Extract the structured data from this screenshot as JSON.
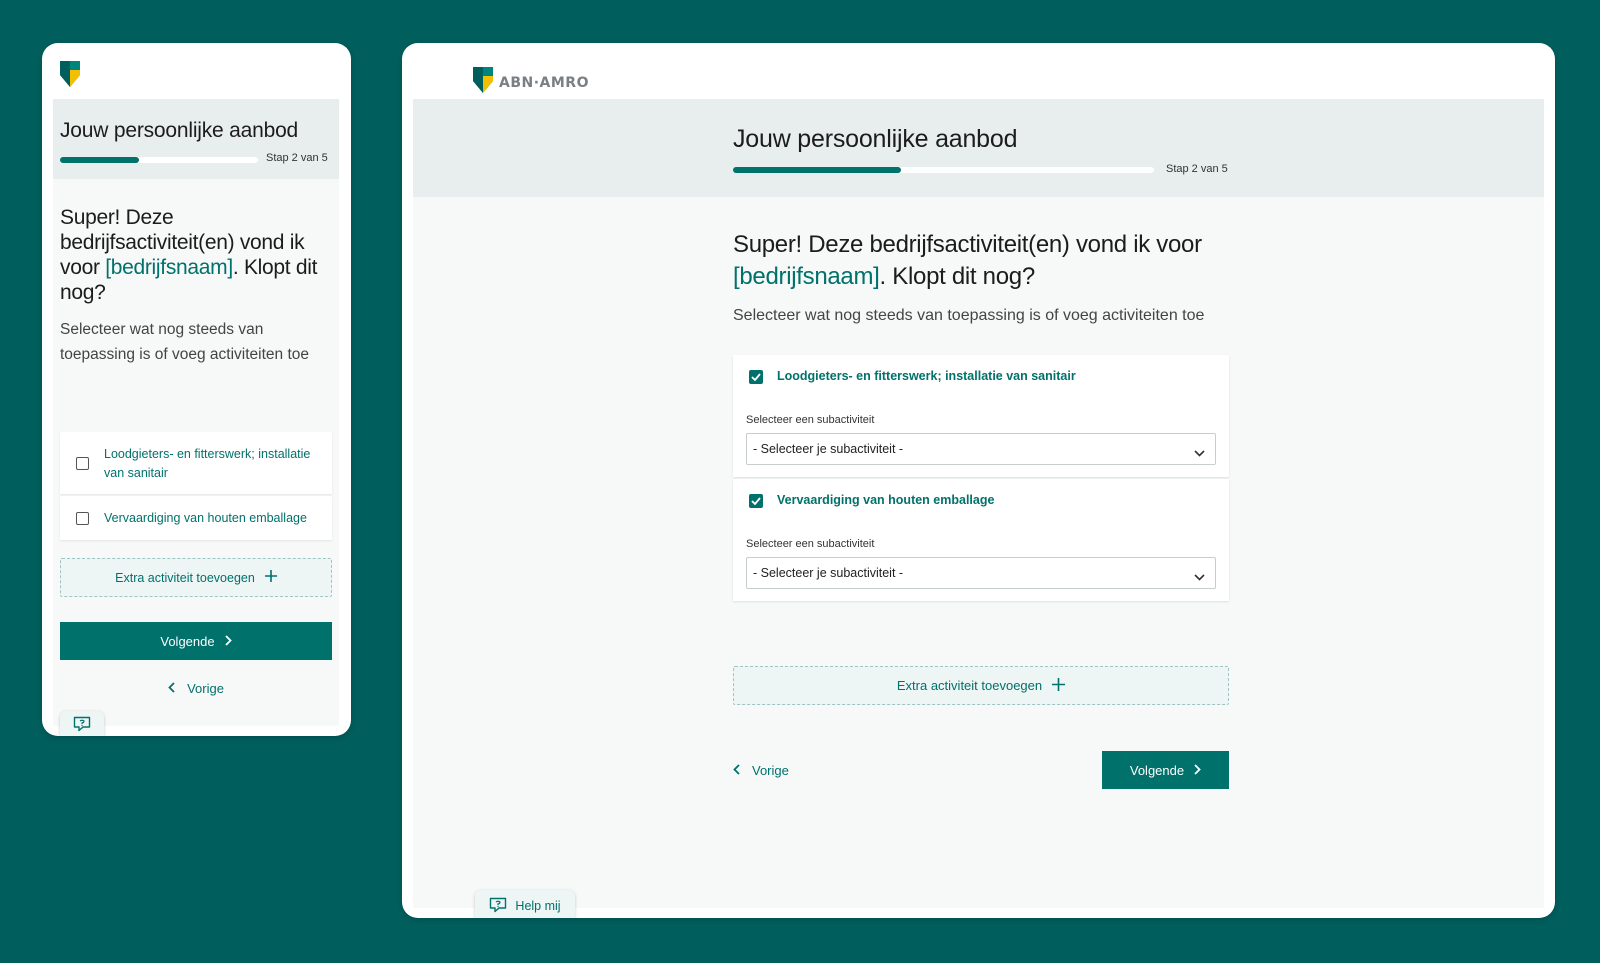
{
  "brand": {
    "name": "ABN·AMRO",
    "accent_color": "#00716b",
    "background_color": "#005e5d"
  },
  "progress": {
    "title": "Jouw persoonlijke aanbod",
    "step_text": "Stap 2 van 5",
    "fraction": 0.4
  },
  "question": {
    "heading_prefix": "Super! Deze bedrijfsactiviteit(en) vond ik voor ",
    "heading_placeholder": "[bedrijfsnaam]",
    "heading_suffix": ". Klopt dit nog?",
    "subtitle": "Selecteer wat nog steeds van toepassing is of voeg activiteiten toe"
  },
  "mobile": {
    "activities": [
      {
        "label": "Loodgieters- en fitterswerk; installatie van sanitair",
        "checked": false
      },
      {
        "label": "Vervaardiging van houten emballage",
        "checked": false
      }
    ]
  },
  "desktop": {
    "activities": [
      {
        "label": "Loodgieters- en fitterswerk; installatie van sanitair",
        "checked": true,
        "select_label": "Selecteer een subactiviteit",
        "select_value": "- Selecteer je subactiviteit -"
      },
      {
        "label": "Vervaardiging van houten emballage",
        "checked": true,
        "select_label": "Selecteer een subactiviteit",
        "select_value": "- Selecteer je subactiviteit -"
      }
    ]
  },
  "actions": {
    "add_activity": "Extra activiteit toevoegen",
    "next": "Volgende",
    "previous": "Vorige",
    "help": "Help mij"
  },
  "icons": [
    "shield-logo-icon",
    "plus-icon",
    "chevron-right-icon",
    "chevron-left-icon",
    "chevron-down-icon",
    "checkmark-icon",
    "chat-help-icon"
  ]
}
